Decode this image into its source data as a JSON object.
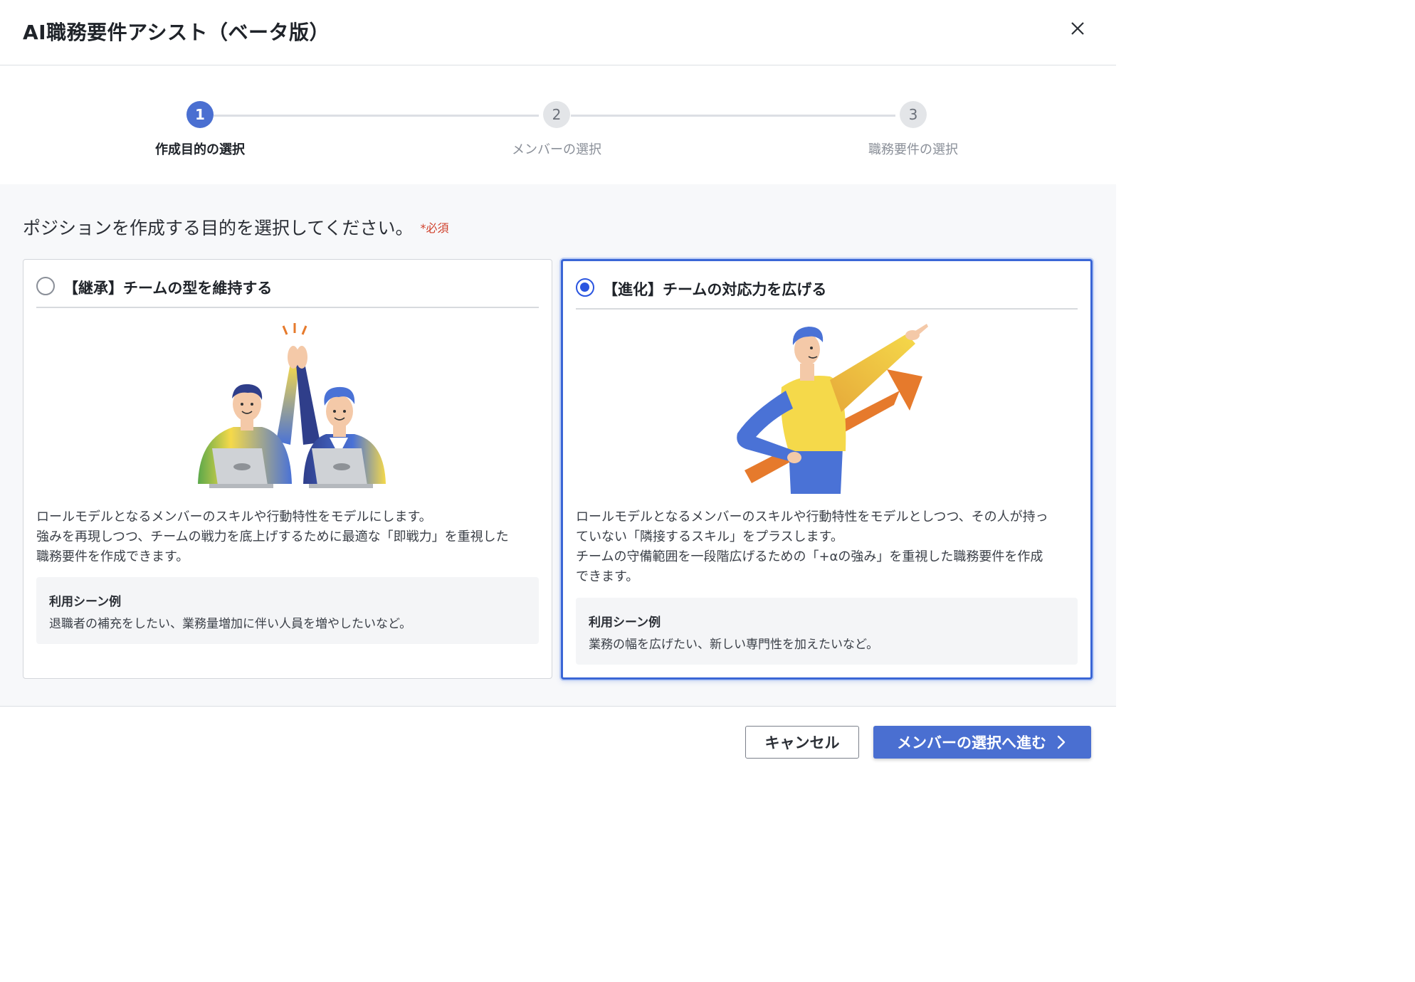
{
  "dialog": {
    "title": "AI職務要件アシスト（ベータ版）",
    "close_icon": "close-icon"
  },
  "stepper": {
    "steps": [
      {
        "number": "1",
        "label": "作成目的の選択",
        "state": "active"
      },
      {
        "number": "2",
        "label": "メンバーの選択",
        "state": "inactive"
      },
      {
        "number": "3",
        "label": "職務要件の選択",
        "state": "inactive"
      }
    ]
  },
  "question": {
    "text": "ポジションを作成する目的を選択してください。",
    "required_label": "*必須"
  },
  "options": [
    {
      "title": "【継承】チームの型を維持する",
      "selected": false,
      "illustration": "two-people-high-five-illustration",
      "description": [
        "ロールモデルとなるメンバーのスキルや行動特性をモデルにします。",
        "強みを再現しつつ、チームの戦力を底上げするために最適な「即戦力」を重視した",
        "職務要件を作成できます。"
      ],
      "scene_title": "利用シーン例",
      "scene_text": "退職者の補充をしたい、業務量増加に伴い人員を増やしたいなど。"
    },
    {
      "title": "【進化】チームの対応力を広げる",
      "selected": true,
      "illustration": "person-pointing-arrow-up-illustration",
      "description": [
        "ロールモデルとなるメンバーのスキルや行動特性をモデルとしつつ、その人が持っ",
        "ていない「隣接するスキル」をプラスします。",
        "チームの守備範囲を一段階広げるための「+αの強み」を重視した職務要件を作成",
        "できます。"
      ],
      "scene_title": "利用シーン例",
      "scene_text": "業務の幅を広げたい、新しい専門性を加えたいなど。"
    }
  ],
  "footer": {
    "cancel_label": "キャンセル",
    "next_label": "メンバーの選択へ進む",
    "next_icon": "chevron-right-icon"
  },
  "colors": {
    "primary": "#4a6fd1",
    "selected_border": "#3a66d6",
    "radio_on": "#2a55e0",
    "required": "#d0402b",
    "illustration_yellow": "#f5d94a",
    "illustration_blue": "#4a72d6",
    "illustration_orange": "#e67a2c",
    "illustration_green": "#5ba84a"
  }
}
